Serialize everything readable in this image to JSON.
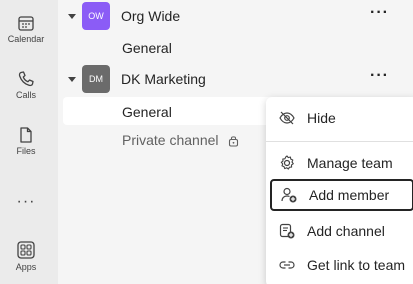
{
  "rail": {
    "items": [
      {
        "label": "Calendar",
        "icon": "calendar-icon"
      },
      {
        "label": "Calls",
        "icon": "phone-icon"
      },
      {
        "label": "Files",
        "icon": "file-icon"
      },
      {
        "label": "Apps",
        "icon": "apps-icon"
      }
    ],
    "more": "···"
  },
  "teams": [
    {
      "initials": "OW",
      "name": "Org Wide",
      "color": "#8b5cf6",
      "more": "···",
      "channels": [
        {
          "name": "General"
        }
      ]
    },
    {
      "initials": "DM",
      "name": "DK Marketing",
      "color": "#6b6b6b",
      "more": "···",
      "channels": [
        {
          "name": "General"
        },
        {
          "name": "Private channel"
        }
      ]
    }
  ],
  "menu": {
    "items": [
      {
        "label": "Hide",
        "icon": "eye-off-icon"
      },
      {
        "label": "Manage team",
        "icon": "gear-icon"
      },
      {
        "label": "Add member",
        "icon": "add-person-icon"
      },
      {
        "label": "Add channel",
        "icon": "add-channel-icon"
      },
      {
        "label": "Get link to team",
        "icon": "link-icon"
      }
    ]
  },
  "colors": {
    "accent": "#8b5cf6",
    "selected_bg": "#ffffff"
  }
}
